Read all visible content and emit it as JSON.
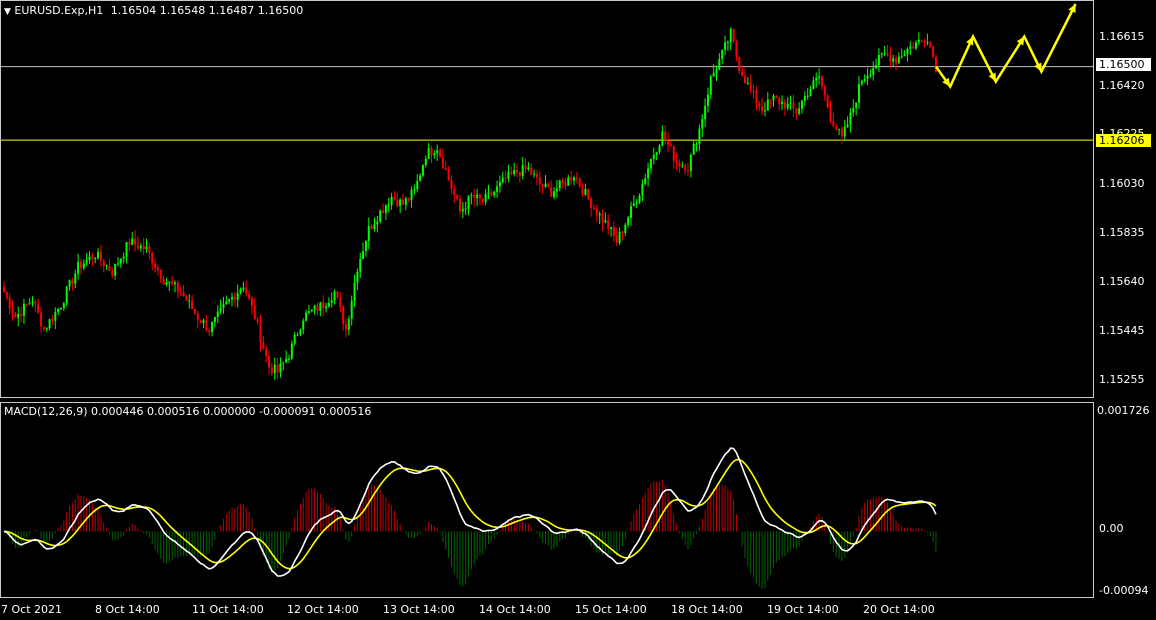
{
  "window": {
    "title": "EURUSD.Exp,H1",
    "ohlc": "1.16504 1.16548 1.16487 1.16500"
  },
  "price_scale": {
    "labels": [
      "1.16615",
      "1.16420",
      "1.16225",
      "1.16030",
      "1.15835",
      "1.15640",
      "1.15445",
      "1.15255"
    ],
    "current_price": "1.16500",
    "level_price": "1.16206"
  },
  "macd": {
    "header": "MACD(12,26,9) 0.000446 0.000516 0.000000 -0.000091 0.000516",
    "scale_labels": [
      "0.001726",
      "0.00",
      "-0.00094"
    ]
  },
  "time_axis": {
    "labels": [
      "7 Oct 2021",
      "8 Oct 14:00",
      "11 Oct 14:00",
      "12 Oct 14:00",
      "13 Oct 14:00",
      "14 Oct 14:00",
      "15 Oct 14:00",
      "18 Oct 14:00",
      "19 Oct 14:00",
      "20 Oct 14:00"
    ]
  },
  "colors": {
    "bull": "#00ff00",
    "bear": "#ff0000",
    "level_line": "#ffff00",
    "price_line": "#c0c0c0",
    "macd_line": "#ffffff",
    "signal_line": "#ffff00",
    "hist_pos": "#c00000",
    "hist_neg": "#006400",
    "arrows": "#ffff00"
  },
  "chart_data": {
    "type": "candlestick",
    "symbol": "EURUSD.Exp",
    "timeframe": "H1",
    "ylim": [
      1.152,
      1.1675
    ],
    "current_price": 1.165,
    "horizontal_level": 1.16206,
    "anchors": [
      [
        0,
        1.156
      ],
      [
        4,
        1.155
      ],
      [
        10,
        1.1557
      ],
      [
        14,
        1.1545
      ],
      [
        20,
        1.1555
      ],
      [
        26,
        1.157
      ],
      [
        32,
        1.1575
      ],
      [
        38,
        1.1568
      ],
      [
        44,
        1.158
      ],
      [
        50,
        1.1577
      ],
      [
        56,
        1.1565
      ],
      [
        62,
        1.156
      ],
      [
        68,
        1.155
      ],
      [
        72,
        1.1545
      ],
      [
        78,
        1.1555
      ],
      [
        84,
        1.1563
      ],
      [
        88,
        1.155
      ],
      [
        93,
        1.153
      ],
      [
        96,
        1.1528
      ],
      [
        100,
        1.1535
      ],
      [
        105,
        1.155
      ],
      [
        112,
        1.1555
      ],
      [
        116,
        1.156
      ],
      [
        120,
        1.1545
      ],
      [
        124,
        1.157
      ],
      [
        128,
        1.1585
      ],
      [
        132,
        1.1592
      ],
      [
        136,
        1.1598
      ],
      [
        140,
        1.1595
      ],
      [
        144,
        1.16
      ],
      [
        148,
        1.1615
      ],
      [
        152,
        1.1618
      ],
      [
        156,
        1.1605
      ],
      [
        160,
        1.1592
      ],
      [
        164,
        1.1598
      ],
      [
        168,
        1.1596
      ],
      [
        172,
        1.16
      ],
      [
        176,
        1.1605
      ],
      [
        180,
        1.1608
      ],
      [
        184,
        1.1609
      ],
      [
        188,
        1.1603
      ],
      [
        192,
        1.16
      ],
      [
        196,
        1.1603
      ],
      [
        200,
        1.1607
      ],
      [
        204,
        1.1599
      ],
      [
        208,
        1.1592
      ],
      [
        212,
        1.1586
      ],
      [
        215,
        1.158
      ],
      [
        219,
        1.159
      ],
      [
        223,
        1.16
      ],
      [
        227,
        1.1613
      ],
      [
        231,
        1.1623
      ],
      [
        236,
        1.1612
      ],
      [
        240,
        1.161
      ],
      [
        244,
        1.1625
      ],
      [
        248,
        1.1645
      ],
      [
        252,
        1.1655
      ],
      [
        255,
        1.1663
      ],
      [
        258,
        1.165
      ],
      [
        262,
        1.164
      ],
      [
        266,
        1.1633
      ],
      [
        270,
        1.1637
      ],
      [
        274,
        1.1635
      ],
      [
        278,
        1.1632
      ],
      [
        282,
        1.164
      ],
      [
        286,
        1.1646
      ],
      [
        290,
        1.163
      ],
      [
        294,
        1.1621
      ],
      [
        297,
        1.163
      ],
      [
        301,
        1.1645
      ],
      [
        305,
        1.165
      ],
      [
        309,
        1.1655
      ],
      [
        313,
        1.1653
      ],
      [
        317,
        1.1657
      ],
      [
        321,
        1.166
      ],
      [
        324,
        1.1662
      ],
      [
        327,
        1.165
      ]
    ],
    "forecast_path": [
      [
        327,
        1.165
      ],
      [
        332,
        1.1642
      ],
      [
        340,
        1.1662
      ],
      [
        348,
        1.1644
      ],
      [
        358,
        1.1662
      ],
      [
        364,
        1.1648
      ],
      [
        376,
        1.1675
      ]
    ],
    "macd_ylim": [
      -0.00105,
      0.0019
    ],
    "macd_zero": 0.0
  }
}
